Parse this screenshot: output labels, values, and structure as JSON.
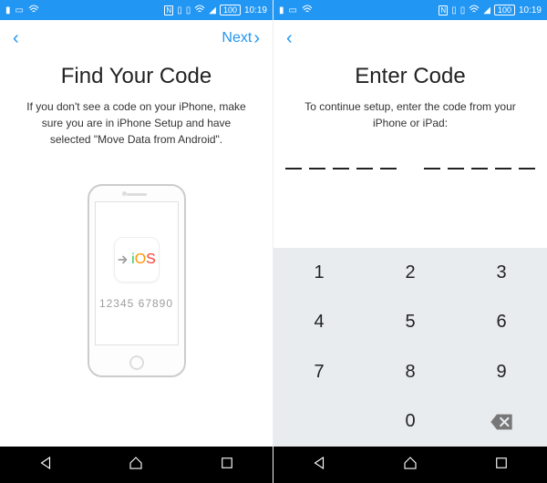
{
  "status": {
    "time": "10:19",
    "battery": "100"
  },
  "left": {
    "next_label": "Next",
    "title": "Find Your Code",
    "subtitle": "If you don't see a code on your iPhone, make sure you are in iPhone Setup and have selected \"Move Data from Android\".",
    "ios_label": "iOS",
    "sample_code": "12345 67890"
  },
  "right": {
    "title": "Enter Code",
    "subtitle": "To continue setup, enter the code from your iPhone or iPad:",
    "code_length": 10
  },
  "keypad": {
    "k1": "1",
    "k2": "2",
    "k3": "3",
    "k4": "4",
    "k5": "5",
    "k6": "6",
    "k7": "7",
    "k8": "8",
    "k9": "9",
    "k0": "0"
  }
}
